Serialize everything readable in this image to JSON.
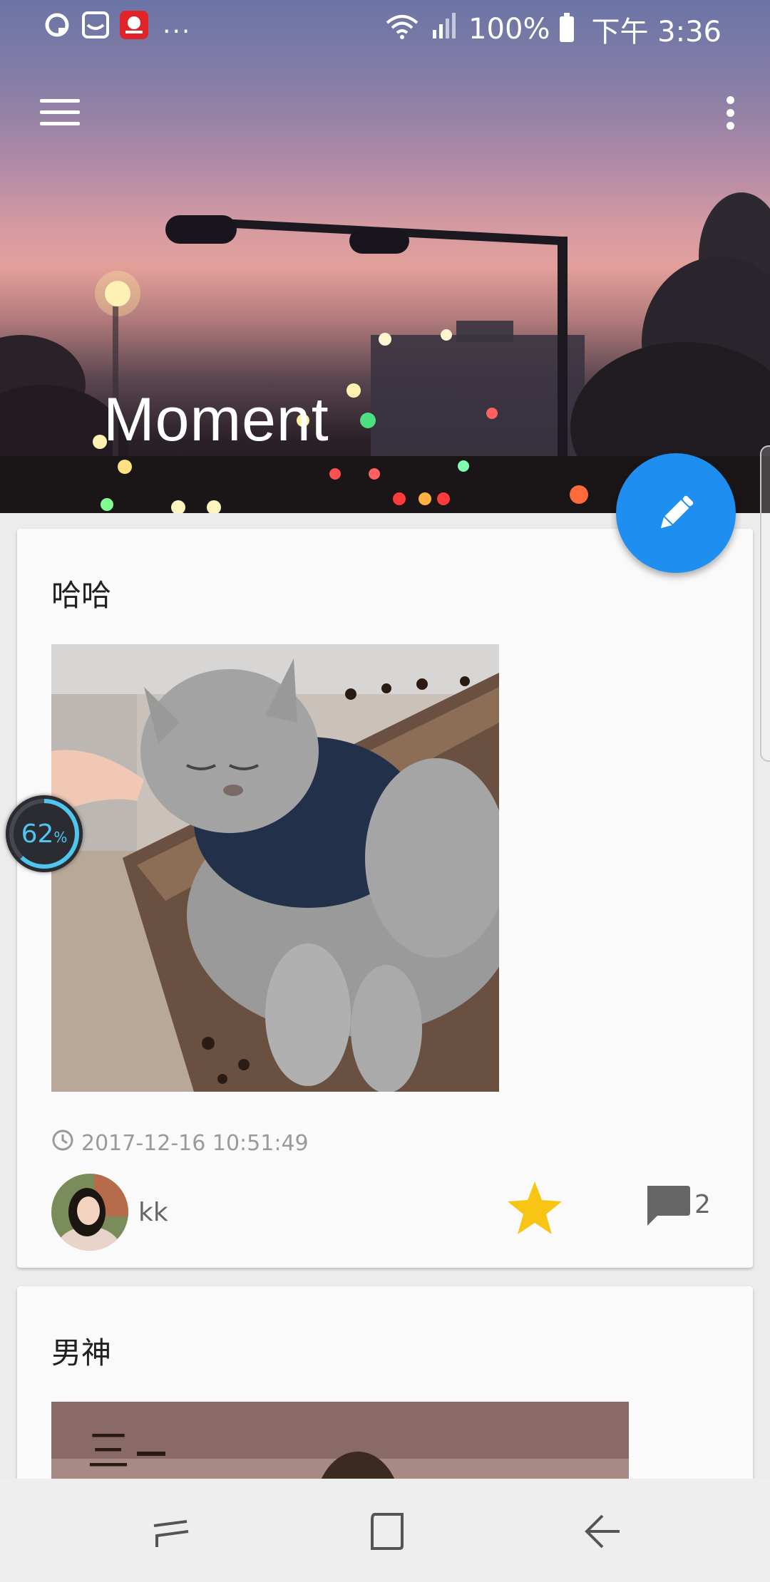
{
  "status_bar": {
    "battery": "100%",
    "time": "下午 3:36",
    "more": "...",
    "notification_icons": [
      "circle-q-icon",
      "inbox-tray-icon",
      "red-app-icon"
    ]
  },
  "toolbar": {
    "title": "Moment",
    "menu_icon": "hamburger-menu-icon",
    "overflow_icon": "more-vert-icon"
  },
  "fab": {
    "icon": "pencil-icon",
    "color": "#1e8ff0"
  },
  "memory_widget": {
    "value": "62",
    "unit": "%"
  },
  "posts": [
    {
      "title": "哈哈",
      "image": "gray-cat-photo",
      "timestamp": "2017-12-16 10:51:49",
      "author": "kk",
      "starred": true,
      "comment_count": "2"
    },
    {
      "title": "男神",
      "image": "man-portrait-photo"
    }
  ],
  "colors": {
    "star": "#f9c514",
    "accent": "#1e8ff0",
    "memory_ring": "#4fc6f0"
  },
  "nav_bar": [
    "recents-icon",
    "home-icon",
    "back-icon"
  ]
}
